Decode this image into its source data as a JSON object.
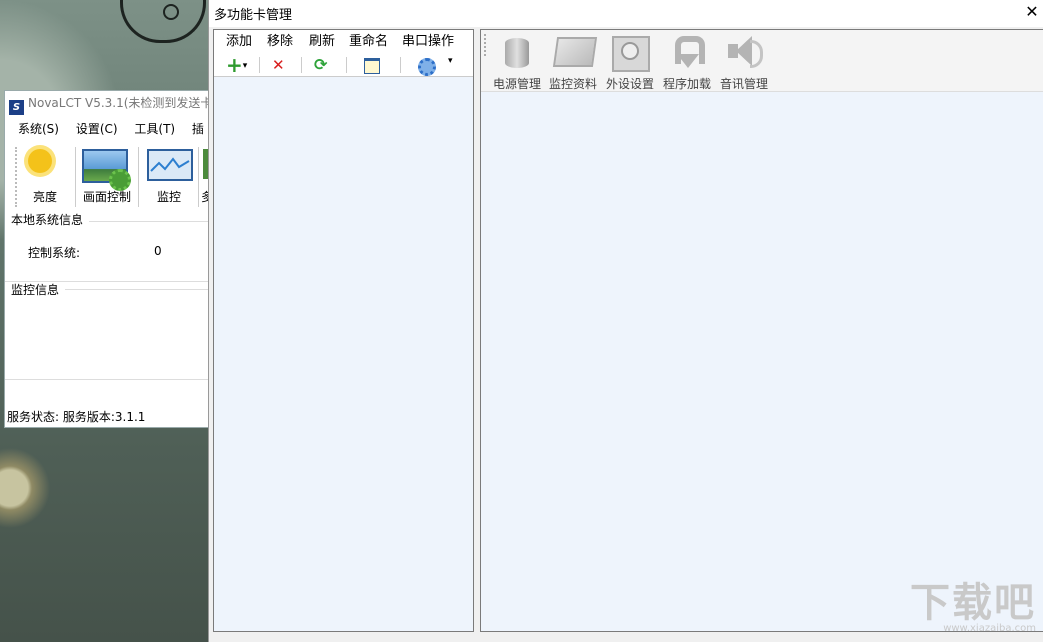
{
  "back_window": {
    "title": "NovaLCT V5.3.1(未检测到发送卡",
    "logo_text": "S",
    "menu": [
      "系统(S)",
      "设置(C)",
      "工具(T)",
      "插"
    ],
    "tools": [
      "亮度",
      "画面控制",
      "监控",
      "多"
    ],
    "section_local": "本地系统信息",
    "control_label": "控制系统:",
    "control_value": "0",
    "section_monitor": "监控信息",
    "status": "服务状态: 服务版本:3.1.1"
  },
  "main_window": {
    "title": "多功能卡管理",
    "close_glyph": "✕",
    "left_menu": [
      "添加",
      "移除",
      "刷新",
      "重命名",
      "串口操作"
    ],
    "left_tools": {
      "add": "+",
      "remove": "✕",
      "refresh": "⟳",
      "dropdown": "▾"
    },
    "right_tools": [
      "电源管理",
      "监控资料",
      "外设设置",
      "程序加载",
      "音讯管理"
    ]
  },
  "watermark": {
    "main": "下载吧",
    "sub": "www.xiazaiba.com"
  }
}
